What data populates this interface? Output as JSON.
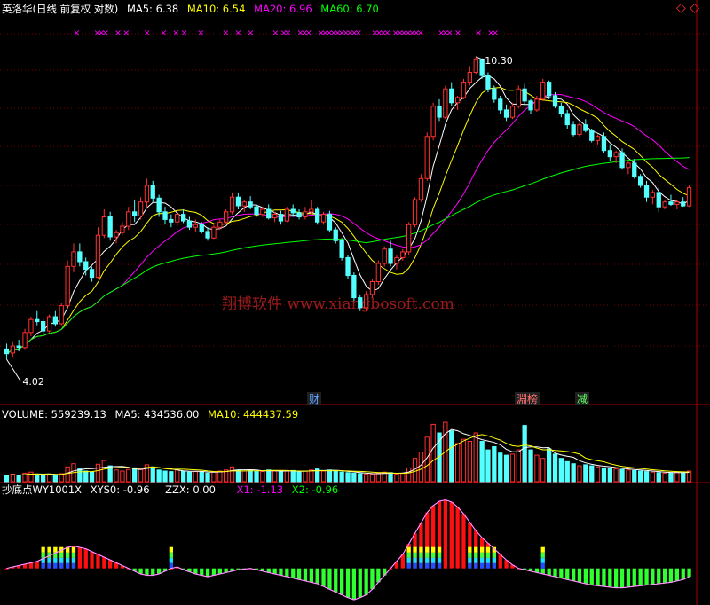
{
  "colors": {
    "bg": "#000000",
    "up": "#ff3030",
    "down": "#54ffff",
    "ma5": "#ffffff",
    "ma10": "#ffff00",
    "ma20": "#ff00ff",
    "ma60": "#00ff00",
    "separator": "#b00000",
    "grid": "#7a0000",
    "marker": "#ff00ff",
    "watermark": "#b02020"
  },
  "header": {
    "title": "英洛华(日线 前复权 对数)",
    "ma5": "MA5: 6.38",
    "ma10": "MA10: 6.54",
    "ma20": "MA20: 6.96",
    "ma60": "MA60: 6.70",
    "corner_icons": "◇ ◇"
  },
  "volume_header": {
    "volume": "VOLUME: 559239.13",
    "ma5": "MA5: 434536.00",
    "ma10": "MA10: 444437.59"
  },
  "indicator_header": {
    "name": "抄底点WY1001X",
    "xys0": "XYS0: -0.96",
    "zzx": "ZZX: 0.00",
    "x1": "X1: -1.13",
    "x2": "X2: -0.96"
  },
  "annotations": {
    "low": "4.02",
    "high": "10.30",
    "event_1": "财",
    "event_2": "淵榜",
    "event_3": "减"
  },
  "watermark": "翔博软件 www.xiangbosoft.com",
  "chart_data": [
    {
      "type": "candlestick",
      "panel": "price",
      "scale": "log",
      "ylim": [
        3.6,
        11.2
      ],
      "series": [
        {
          "name": "K",
          "ohlc": [
            [
              4.08,
              4.15,
              3.95,
              4.02
            ],
            [
              4.03,
              4.18,
              3.98,
              4.12
            ],
            [
              4.12,
              4.2,
              4.05,
              4.1
            ],
            [
              4.1,
              4.35,
              4.08,
              4.3
            ],
            [
              4.3,
              4.52,
              4.25,
              4.48
            ],
            [
              4.48,
              4.6,
              4.4,
              4.45
            ],
            [
              4.45,
              4.5,
              4.28,
              4.32
            ],
            [
              4.32,
              4.55,
              4.3,
              4.52
            ],
            [
              4.52,
              4.6,
              4.38,
              4.42
            ],
            [
              4.42,
              4.72,
              4.4,
              4.68
            ],
            [
              4.68,
              5.4,
              4.65,
              5.3
            ],
            [
              5.3,
              5.7,
              5.2,
              5.55
            ],
            [
              5.55,
              5.7,
              5.3,
              5.38
            ],
            [
              5.38,
              5.45,
              5.15,
              5.25
            ],
            [
              5.25,
              5.3,
              5.05,
              5.12
            ],
            [
              5.12,
              6.0,
              5.1,
              5.85
            ],
            [
              5.85,
              6.35,
              5.8,
              6.2
            ],
            [
              6.2,
              6.3,
              5.75,
              5.82
            ],
            [
              5.82,
              5.95,
              5.7,
              5.9
            ],
            [
              5.9,
              6.1,
              5.85,
              6.02
            ],
            [
              6.02,
              6.4,
              5.95,
              6.3
            ],
            [
              6.3,
              6.55,
              6.1,
              6.22
            ],
            [
              6.22,
              6.6,
              6.15,
              6.5
            ],
            [
              6.5,
              7.0,
              6.4,
              6.85
            ],
            [
              6.85,
              6.95,
              6.5,
              6.58
            ],
            [
              6.58,
              6.65,
              6.2,
              6.3
            ],
            [
              6.3,
              6.4,
              6.05,
              6.15
            ],
            [
              6.15,
              6.25,
              6.0,
              6.1
            ],
            [
              6.1,
              6.3,
              6.02,
              6.25
            ],
            [
              6.25,
              6.35,
              6.08,
              6.12
            ],
            [
              6.12,
              6.2,
              5.95,
              6.0
            ],
            [
              6.0,
              6.15,
              5.9,
              6.05
            ],
            [
              6.05,
              6.1,
              5.88,
              5.92
            ],
            [
              5.92,
              6.0,
              5.75,
              5.8
            ],
            [
              5.8,
              6.05,
              5.78,
              6.0
            ],
            [
              6.0,
              6.15,
              5.95,
              6.1
            ],
            [
              6.1,
              6.35,
              6.05,
              6.3
            ],
            [
              6.3,
              6.7,
              6.25,
              6.6
            ],
            [
              6.6,
              6.7,
              6.35,
              6.42
            ],
            [
              6.42,
              6.55,
              6.3,
              6.5
            ],
            [
              6.5,
              6.62,
              6.35,
              6.4
            ],
            [
              6.4,
              6.45,
              6.2,
              6.25
            ],
            [
              6.25,
              6.4,
              6.2,
              6.35
            ],
            [
              6.35,
              6.45,
              6.15,
              6.18
            ],
            [
              6.18,
              6.3,
              6.1,
              6.25
            ],
            [
              6.25,
              6.32,
              6.05,
              6.12
            ],
            [
              6.12,
              6.4,
              6.1,
              6.35
            ],
            [
              6.35,
              6.45,
              6.2,
              6.28
            ],
            [
              6.28,
              6.35,
              6.15,
              6.2
            ],
            [
              6.2,
              6.4,
              6.15,
              6.3
            ],
            [
              6.3,
              6.55,
              6.25,
              6.35
            ],
            [
              6.35,
              6.4,
              6.05,
              6.1
            ],
            [
              6.1,
              6.3,
              6.05,
              6.25
            ],
            [
              6.25,
              6.32,
              5.9,
              5.95
            ],
            [
              5.95,
              6.0,
              5.7,
              5.75
            ],
            [
              5.75,
              5.8,
              5.4,
              5.45
            ],
            [
              5.45,
              5.5,
              5.1,
              5.15
            ],
            [
              5.15,
              5.2,
              4.75,
              4.8
            ],
            [
              4.8,
              4.85,
              4.6,
              4.65
            ],
            [
              4.65,
              4.9,
              4.6,
              4.85
            ],
            [
              4.85,
              5.1,
              4.8,
              5.05
            ],
            [
              5.05,
              5.4,
              5.0,
              5.35
            ],
            [
              5.35,
              5.65,
              5.3,
              5.6
            ],
            [
              5.6,
              5.75,
              5.3,
              5.35
            ],
            [
              5.35,
              5.5,
              5.25,
              5.45
            ],
            [
              5.45,
              5.6,
              5.4,
              5.55
            ],
            [
              5.55,
              6.1,
              5.5,
              6.05
            ],
            [
              6.05,
              6.6,
              6.0,
              6.55
            ],
            [
              6.55,
              7.1,
              6.5,
              7.0
            ],
            [
              7.0,
              8.1,
              6.95,
              8.0
            ],
            [
              8.0,
              8.9,
              7.9,
              8.8
            ],
            [
              8.8,
              9.0,
              8.4,
              8.5
            ],
            [
              8.5,
              9.4,
              8.45,
              9.3
            ],
            [
              9.3,
              9.5,
              8.8,
              8.9
            ],
            [
              8.9,
              9.1,
              8.7,
              9.05
            ],
            [
              9.05,
              9.6,
              9.0,
              9.5
            ],
            [
              9.5,
              10.0,
              9.4,
              9.8
            ],
            [
              9.8,
              10.3,
              9.75,
              10.2
            ],
            [
              10.2,
              10.25,
              9.6,
              9.7
            ],
            [
              9.7,
              9.8,
              9.2,
              9.3
            ],
            [
              9.3,
              9.4,
              8.9,
              9.0
            ],
            [
              9.0,
              9.1,
              8.6,
              8.7
            ],
            [
              8.7,
              8.85,
              8.4,
              8.5
            ],
            [
              8.5,
              8.9,
              8.45,
              8.8
            ],
            [
              8.8,
              9.4,
              8.75,
              9.3
            ],
            [
              9.3,
              9.45,
              8.85,
              8.95
            ],
            [
              8.95,
              9.0,
              8.6,
              8.7
            ],
            [
              8.7,
              9.1,
              8.65,
              9.0
            ],
            [
              9.0,
              9.6,
              8.95,
              9.5
            ],
            [
              9.5,
              9.55,
              9.0,
              9.1
            ],
            [
              9.1,
              9.2,
              8.75,
              8.8
            ],
            [
              8.8,
              8.9,
              8.5,
              8.6
            ],
            [
              8.6,
              8.7,
              8.2,
              8.3
            ],
            [
              8.3,
              8.4,
              8.0,
              8.05
            ],
            [
              8.05,
              8.35,
              8.0,
              8.3
            ],
            [
              8.3,
              8.45,
              8.1,
              8.15
            ],
            [
              8.15,
              8.2,
              7.85,
              7.9
            ],
            [
              7.9,
              8.05,
              7.8,
              8.0
            ],
            [
              8.0,
              8.1,
              7.6,
              7.65
            ],
            [
              7.65,
              7.8,
              7.4,
              7.5
            ],
            [
              7.5,
              7.65,
              7.35,
              7.6
            ],
            [
              7.6,
              7.7,
              7.2,
              7.25
            ],
            [
              7.25,
              7.4,
              7.1,
              7.35
            ],
            [
              7.35,
              7.45,
              7.0,
              7.05
            ],
            [
              7.05,
              7.1,
              6.8,
              6.85
            ],
            [
              6.85,
              6.95,
              6.5,
              6.6
            ],
            [
              6.6,
              6.75,
              6.45,
              6.7
            ],
            [
              6.7,
              6.8,
              6.3,
              6.4
            ],
            [
              6.4,
              6.55,
              6.35,
              6.5
            ],
            [
              6.5,
              6.65,
              6.42,
              6.45
            ],
            [
              6.45,
              6.55,
              6.35,
              6.5
            ],
            [
              6.5,
              6.6,
              6.4,
              6.42
            ],
            [
              6.42,
              6.85,
              6.4,
              6.8
            ]
          ]
        }
      ]
    },
    {
      "type": "bar",
      "panel": "volume",
      "ylim": [
        0,
        560000
      ],
      "values": [
        60000,
        70000,
        55000,
        80000,
        90000,
        70000,
        60000,
        65000,
        60000,
        75000,
        140000,
        170000,
        120000,
        100000,
        90000,
        165000,
        200000,
        150000,
        110000,
        100000,
        115000,
        130000,
        120000,
        160000,
        140000,
        110000,
        100000,
        95000,
        110000,
        100000,
        90000,
        95000,
        90000,
        80000,
        95000,
        100000,
        110000,
        140000,
        110000,
        100000,
        105000,
        100000,
        95000,
        110000,
        100000,
        95000,
        100000,
        105000,
        95000,
        100000,
        110000,
        120000,
        100000,
        110000,
        100000,
        90000,
        85000,
        80000,
        75000,
        70000,
        70000,
        80000,
        90000,
        85000,
        70000,
        80000,
        130000,
        220000,
        280000,
        420000,
        540000,
        460000,
        560000,
        480000,
        360000,
        400000,
        380000,
        460000,
        380000,
        300000,
        330000,
        270000,
        250000,
        260000,
        300000,
        530000,
        300000,
        250000,
        220000,
        310000,
        260000,
        220000,
        190000,
        170000,
        150000,
        160000,
        150000,
        140000,
        130000,
        125000,
        120000,
        115000,
        110000,
        105000,
        100000,
        95000,
        90000,
        85000,
        80000,
        85000,
        90000,
        85000,
        100000
      ]
    },
    {
      "type": "bar",
      "panel": "indicator",
      "ylim": [
        -0.5,
        1.0
      ],
      "values": [
        0.0,
        0.02,
        0.04,
        0.06,
        0.08,
        0.1,
        0.14,
        0.18,
        0.22,
        0.26,
        0.3,
        0.32,
        0.3,
        0.28,
        0.24,
        0.2,
        0.16,
        0.12,
        0.08,
        0.04,
        0.0,
        -0.04,
        -0.08,
        -0.1,
        -0.1,
        -0.08,
        -0.04,
        0.0,
        0.02,
        -0.02,
        -0.05,
        -0.08,
        -0.1,
        -0.12,
        -0.1,
        -0.08,
        -0.06,
        -0.04,
        -0.02,
        -0.01,
        0.0,
        -0.02,
        -0.04,
        -0.06,
        -0.08,
        -0.1,
        -0.12,
        -0.14,
        -0.16,
        -0.18,
        -0.2,
        -0.22,
        -0.26,
        -0.3,
        -0.34,
        -0.38,
        -0.42,
        -0.45,
        -0.42,
        -0.38,
        -0.3,
        -0.2,
        -0.1,
        0.0,
        0.1,
        0.2,
        0.35,
        0.5,
        0.65,
        0.8,
        0.9,
        0.96,
        0.98,
        0.95,
        0.88,
        0.78,
        0.66,
        0.54,
        0.44,
        0.36,
        0.28,
        0.2,
        0.12,
        0.05,
        0.0,
        -0.02,
        -0.04,
        -0.06,
        -0.08,
        -0.1,
        -0.12,
        -0.14,
        -0.16,
        -0.18,
        -0.2,
        -0.22,
        -0.24,
        -0.25,
        -0.26,
        -0.27,
        -0.28,
        -0.28,
        -0.27,
        -0.26,
        -0.25,
        -0.24,
        -0.23,
        -0.22,
        -0.21,
        -0.2,
        -0.18,
        -0.16,
        -0.12
      ]
    }
  ]
}
